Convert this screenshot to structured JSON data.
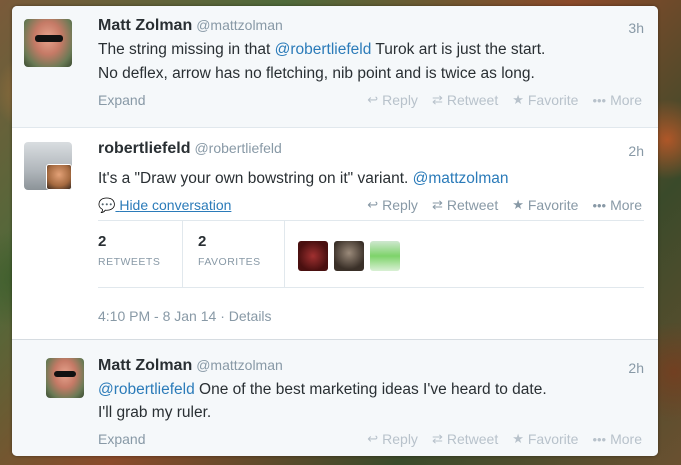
{
  "tweets": [
    {
      "name": "Matt Zolman",
      "handle": "@mattzolman",
      "time": "3h",
      "line1_pre": "The string missing in that ",
      "line1_mention": "@robertliefeld",
      "line1_post": " Turok art is just the start.",
      "line2": "No deflex, arrow has no fletching, nib point and is twice as long.",
      "expand": "Expand",
      "actions": {
        "reply": "Reply",
        "retweet": "Retweet",
        "favorite": "Favorite",
        "more": "More"
      }
    },
    {
      "name": "robertliefeld",
      "handle": "@robertliefeld",
      "time": "2h",
      "line1_pre": "It's a \"Draw your own bowstring on it\" variant. ",
      "line1_mention": "@mattzolman",
      "hide_conversation": "Hide conversation",
      "actions": {
        "reply": "Reply",
        "retweet": "Retweet",
        "favorite": "Favorite",
        "more": "More"
      },
      "retweets_count": "2",
      "retweets_label": "RETWEETS",
      "favorites_count": "2",
      "favorites_label": "FAVORITES",
      "timestamp": "4:10 PM - 8 Jan 14",
      "details": "Details"
    },
    {
      "name": "Matt Zolman",
      "handle": "@mattzolman",
      "time": "2h",
      "line1_mention": "@robertliefeld",
      "line1_post": " One of the best marketing ideas I've heard to date.",
      "line2": "I'll grab my ruler.",
      "expand": "Expand",
      "actions": {
        "reply": "Reply",
        "retweet": "Retweet",
        "favorite": "Favorite",
        "more": "More"
      }
    }
  ],
  "icons": {
    "reply": "reply-arrow-icon",
    "retweet": "retweet-icon",
    "favorite": "star-icon",
    "more": "ellipsis-icon",
    "conversation": "speech-bubble-icon"
  },
  "colors": {
    "link": "#2b7bb9",
    "muted": "#8899a6",
    "text": "#292f33"
  }
}
